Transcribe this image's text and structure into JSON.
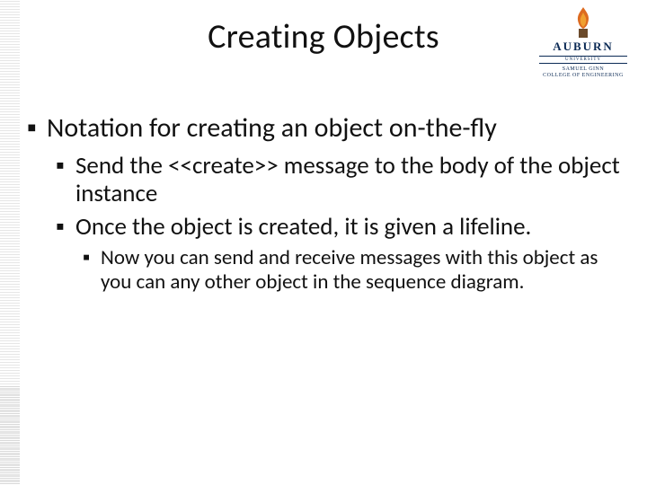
{
  "title": "Creating Objects",
  "brand": {
    "word": "AUBURN",
    "sub1": "UNIVERSITY",
    "sub2_line1": "SAMUEL GINN",
    "sub2_line2": "COLLEGE OF ENGINEERING"
  },
  "bullets": {
    "l1": {
      "mark": "▪",
      "text": "Notation for creating an object on-the-fly"
    },
    "l2a": {
      "mark": "▪",
      "text": "Send the <<create>> message to the body of the object instance"
    },
    "l2b": {
      "mark": "▪",
      "text": "Once the object is created, it is given a lifeline."
    },
    "l3": {
      "mark": "▪",
      "text": "Now you can send and receive messages with this object as you can any other object in the sequence diagram."
    }
  }
}
